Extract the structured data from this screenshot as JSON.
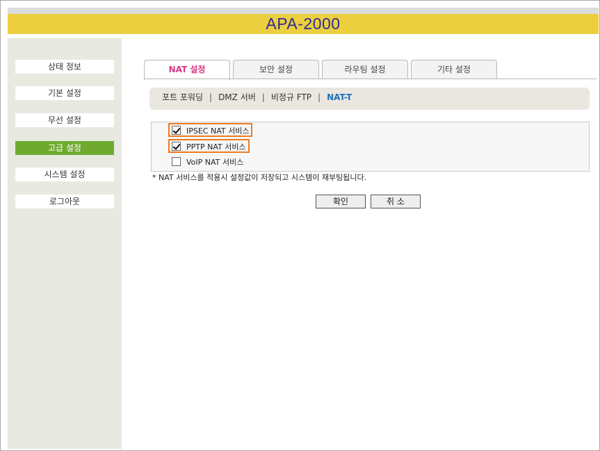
{
  "header": {
    "title": "APA-2000"
  },
  "sidebar": {
    "items": [
      {
        "label": "상태 정보",
        "active": false
      },
      {
        "label": "기본 설정",
        "active": false
      },
      {
        "label": "무선 설정",
        "active": false
      },
      {
        "label": "고급 설정",
        "active": true
      },
      {
        "label": "시스템 설정",
        "active": false
      },
      {
        "label": "로그아웃",
        "active": false
      }
    ]
  },
  "tabs": [
    {
      "label": "NAT 설정",
      "active": true
    },
    {
      "label": "보안 설정",
      "active": false
    },
    {
      "label": "라우팅 설정",
      "active": false
    },
    {
      "label": "기타 설정",
      "active": false
    }
  ],
  "subnav": {
    "items": [
      "포트 포워딩",
      "DMZ 서버",
      "비정규 FTP",
      "NAT-T"
    ],
    "separator": "|",
    "active": "NAT-T"
  },
  "options": [
    {
      "label": "IPSEC NAT 서비스",
      "checked": true,
      "highlighted": true
    },
    {
      "label": "PPTP NAT 서비스",
      "checked": true,
      "highlighted": true
    },
    {
      "label": "VoIP NAT 서비스",
      "checked": false,
      "highlighted": false
    }
  ],
  "note": "* NAT 서비스를 적용시 설정값이 저장되고 시스템이 재부팅됩니다.",
  "buttons": {
    "confirm": "확인",
    "cancel": "취 소"
  },
  "colors": {
    "header_bg": "#eccf3f",
    "header_text": "#2d2b93",
    "sidebar_bg": "#e8eae1",
    "sidebar_active": "#6faa2e",
    "tab_active_text": "#d63a86",
    "subnav_active": "#1d6fb8",
    "highlight_border": "#ec7a22"
  }
}
